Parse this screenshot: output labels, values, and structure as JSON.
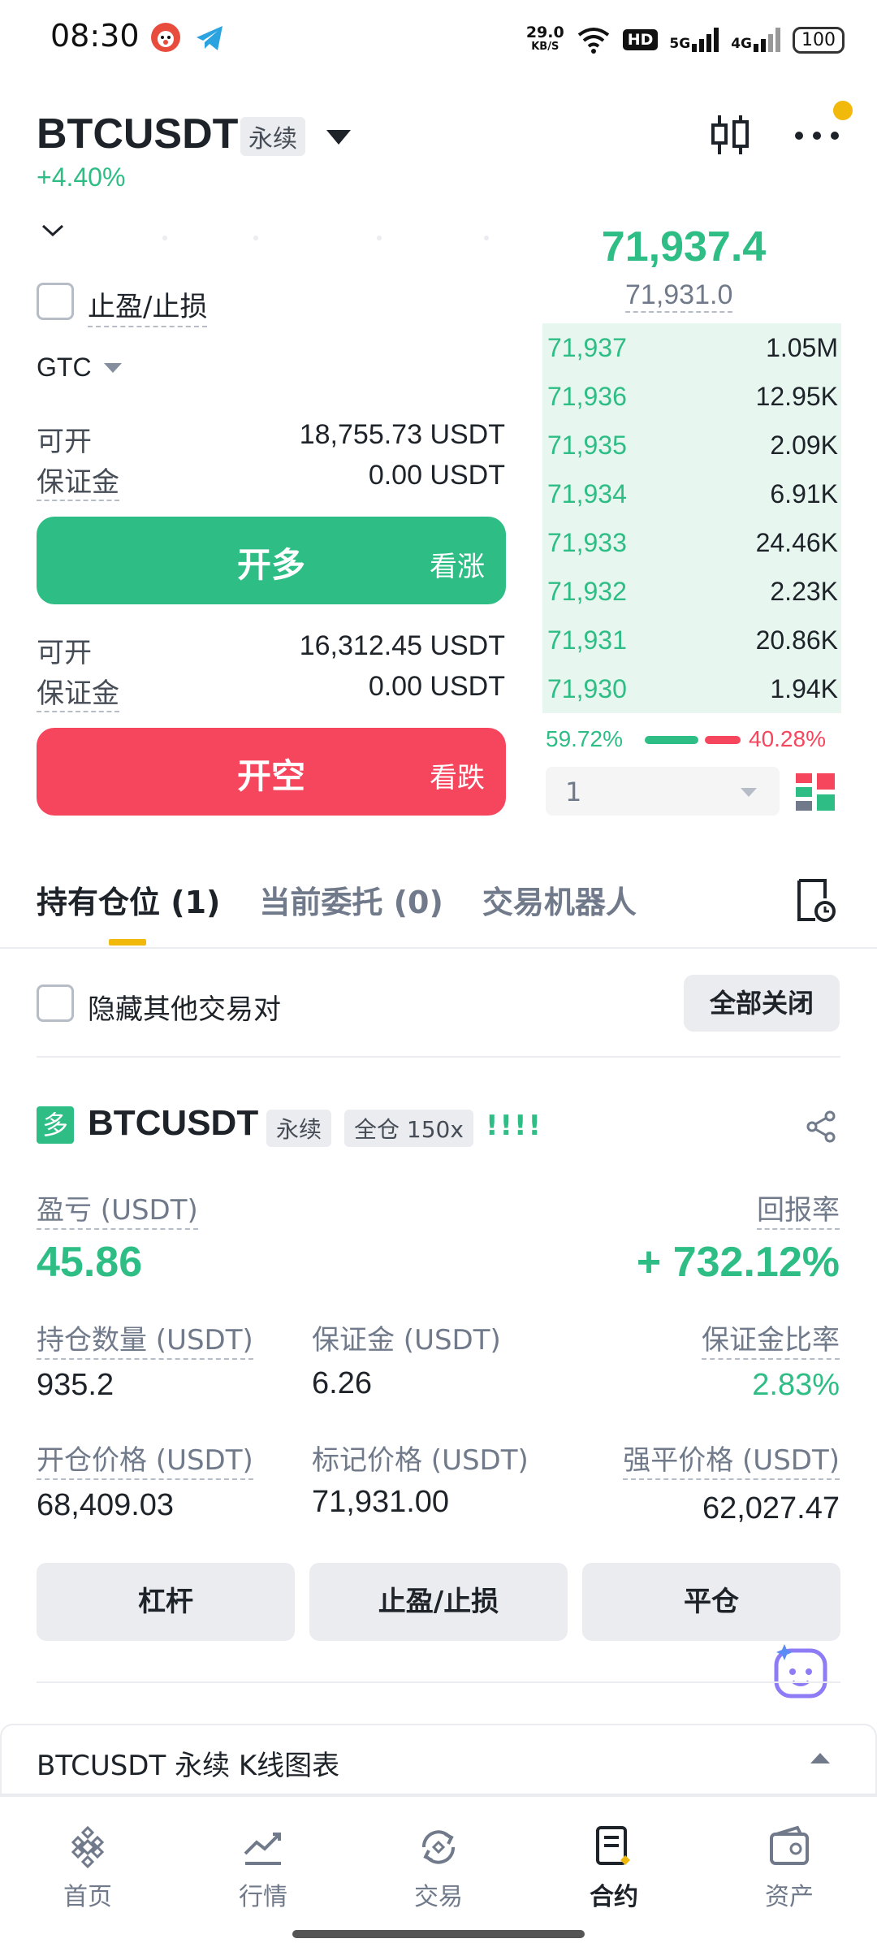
{
  "status_bar": {
    "time": "08:30",
    "net_speed_value": "29.0",
    "net_speed_unit": "KB/S",
    "hd": "HD",
    "sig1": "5G",
    "sig2": "4G",
    "battery": "100"
  },
  "header": {
    "symbol": "BTCUSDT",
    "contract_type": "永续",
    "change_pct": "+4.40%"
  },
  "order_form": {
    "tpsl_label": "止盈/止损",
    "time_in_force": "GTC",
    "long": {
      "available_label": "可开",
      "available_value": "18,755.73 USDT",
      "margin_label": "保证金",
      "margin_value": "0.00 USDT",
      "button_main": "开多",
      "button_sub": "看涨"
    },
    "short": {
      "available_label": "可开",
      "available_value": "16,312.45 USDT",
      "margin_label": "保证金",
      "margin_value": "0.00 USDT",
      "button_main": "开空",
      "button_sub": "看跌"
    }
  },
  "order_book": {
    "last_price": "71,937.4",
    "mark_price": "71,931.0",
    "rows": [
      {
        "price": "71,937",
        "qty": "1.05M",
        "depth": 1.0
      },
      {
        "price": "71,936",
        "qty": "12.95K",
        "depth": 1.0
      },
      {
        "price": "71,935",
        "qty": "2.09K",
        "depth": 1.0
      },
      {
        "price": "71,934",
        "qty": "6.91K",
        "depth": 1.0
      },
      {
        "price": "71,933",
        "qty": "24.46K",
        "depth": 1.0
      },
      {
        "price": "71,932",
        "qty": "2.23K",
        "depth": 1.0
      },
      {
        "price": "71,931",
        "qty": "20.86K",
        "depth": 1.0
      },
      {
        "price": "71,930",
        "qty": "1.94K",
        "depth": 1.0
      }
    ],
    "buy_ratio": "59.72%",
    "sell_ratio": "40.28%",
    "precision_value": "1"
  },
  "tabs": {
    "positions": "持有仓位 (1)",
    "open_orders": "当前委托 (0)",
    "bots": "交易机器人"
  },
  "filter": {
    "hide_other_label": "隐藏其他交易对",
    "close_all": "全部关闭"
  },
  "position": {
    "side_badge": "多",
    "symbol": "BTCUSDT",
    "contract_type": "永续",
    "margin_mode": "全仓 150x",
    "risk_bars": "!!!!",
    "pnl_label": "盈亏 (USDT)",
    "pnl_value": "45.86",
    "roe_label": "回报率",
    "roe_value": "+ 732.12%",
    "size_label": "持仓数量 (USDT)",
    "size_value": "935.2",
    "margin_label": "保证金 (USDT)",
    "margin_value": "6.26",
    "margin_ratio_label": "保证金比率",
    "margin_ratio_value": "2.83%",
    "entry_label": "开仓价格 (USDT)",
    "entry_value": "68,409.03",
    "mark_label": "标记价格 (USDT)",
    "mark_value": "71,931.00",
    "liq_label": "强平价格 (USDT)",
    "liq_value": "62,027.47",
    "btn_leverage": "杠杆",
    "btn_tpsl": "止盈/止损",
    "btn_close": "平仓"
  },
  "kline": {
    "label": "BTCUSDT 永续 K线图表"
  },
  "nav": {
    "home": "首页",
    "markets": "行情",
    "trade": "交易",
    "futures": "合约",
    "assets": "资产"
  },
  "colors": {
    "buy": "#2ebd85",
    "sell": "#f6465d",
    "accent": "#f0b90b"
  }
}
